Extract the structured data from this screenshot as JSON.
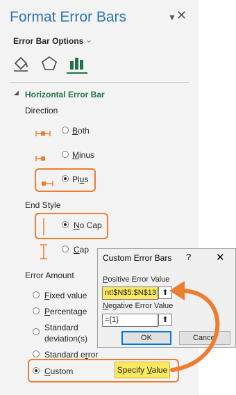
{
  "pane": {
    "title": "Format Error Bars",
    "options_label": "Error Bar Options",
    "tabs": [
      {
        "icon": "fill-line-icon"
      },
      {
        "icon": "effects-pentagon-icon"
      },
      {
        "icon": "bar-chart-icon"
      }
    ],
    "section_title": "Horizontal Error Bar",
    "direction_label": "Direction",
    "direction_options": [
      {
        "label": "Both",
        "selected": false
      },
      {
        "label": "Minus",
        "selected": false
      },
      {
        "label": "Plus",
        "selected": true
      }
    ],
    "end_style_label": "End Style",
    "end_style_options": [
      {
        "label": "No Cap",
        "selected": true
      },
      {
        "label": "Cap",
        "selected": false
      }
    ],
    "error_amount_label": "Error Amount",
    "error_amount_options": [
      {
        "label": "Fixed value",
        "selected": false
      },
      {
        "label": "Percentage",
        "selected": false
      },
      {
        "label": "Standard deviation(s)",
        "line1": "Standard",
        "line2": "deviation(s)",
        "selected": false
      },
      {
        "label": "Standard error",
        "selected": false
      },
      {
        "label": "Custom",
        "selected": true
      }
    ],
    "specify_value_button": "Specify Value"
  },
  "dialog": {
    "title": "Custom Error Bars",
    "help": "?",
    "close": "✕",
    "positive_label": "Positive Error Value",
    "positive_value": "nt!$N$5:$N$13",
    "negative_label": "Negative Error Value",
    "negative_value": "={1}",
    "ok_button": "OK",
    "cancel_button": "Cancel"
  },
  "colors": {
    "title": "#2e75b6",
    "section": "#217346",
    "highlight": "#ed7d31",
    "selection": "#fde960"
  }
}
